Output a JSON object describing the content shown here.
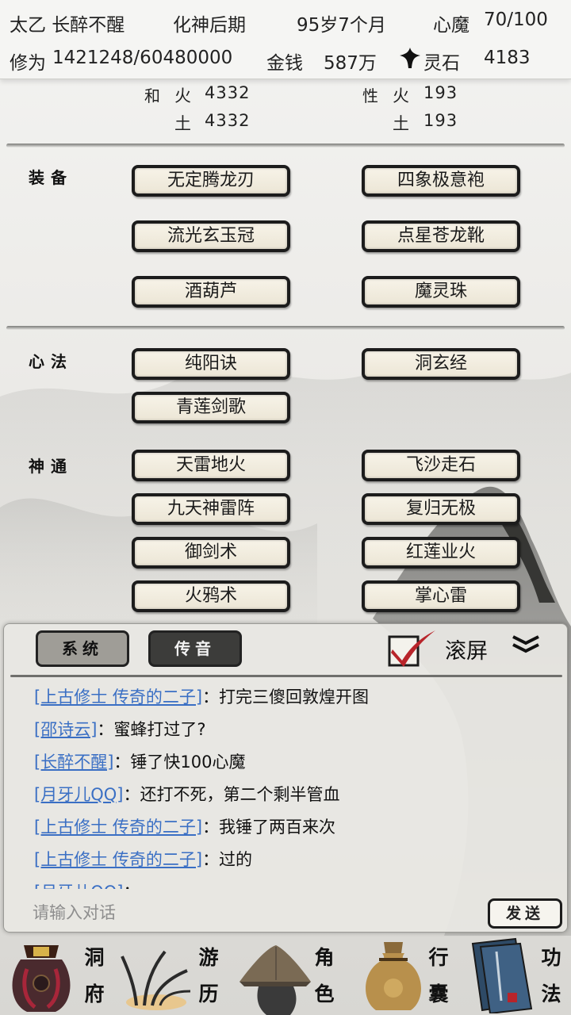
{
  "header": {
    "character_name": "太乙 长醉不醒",
    "realm": "化神后期",
    "age": "95岁7个月",
    "heart_demon_label": "心魔",
    "heart_demon_value": "70/100",
    "cultivation_label": "修为",
    "cultivation_value": "1421248/60480000",
    "money_label": "金钱",
    "money_value": "587万",
    "spirit_stone_label": "灵石",
    "spirit_stone_value": "4183"
  },
  "stats": {
    "left_vertical": "和",
    "left_rows": [
      {
        "element": "火",
        "value": "4332"
      },
      {
        "element": "土",
        "value": "4332"
      }
    ],
    "right_vertical": "性",
    "right_rows": [
      {
        "element": "火",
        "value": "193"
      },
      {
        "element": "土",
        "value": "193"
      }
    ]
  },
  "equipment": {
    "label": "装备",
    "items": [
      "无定腾龙刃",
      "四象极意袍",
      "流光玄玉冠",
      "点星苍龙靴",
      "酒葫芦",
      "魔灵珠"
    ]
  },
  "heart_methods": {
    "label": "心法",
    "items": [
      "纯阳诀",
      "洞玄经",
      "青莲剑歌"
    ]
  },
  "divine_arts": {
    "label": "神通",
    "items": [
      "天雷地火",
      "飞沙走石",
      "九天神雷阵",
      "复归无极",
      "御剑术",
      "红莲业火",
      "火鸦术",
      "掌心雷"
    ]
  },
  "chat": {
    "tab_system": "系统",
    "tab_voice": "传音",
    "scroll_label": "滚屏",
    "messages": [
      {
        "sender": "[上古修士 传奇的二子]",
        "text": "：打完三傻回敦煌开图"
      },
      {
        "sender": "[邵诗云]",
        "text": "：蜜蜂打过了?"
      },
      {
        "sender": "[长醉不醒]",
        "text": "：锤了快100心魔"
      },
      {
        "sender": "[月牙儿QQ]",
        "text": "：还打不死，第二个剩半管血"
      },
      {
        "sender": "[上古修士 传奇的二子]",
        "text": "：我锤了两百来次"
      },
      {
        "sender": "[上古修士 传奇的二子]",
        "text": "：过的"
      },
      {
        "sender": "[月牙儿QQ]",
        "text": "："
      }
    ],
    "input_placeholder": "请输入对话",
    "send_label": "发送"
  },
  "nav": {
    "items": [
      {
        "label_top": "洞",
        "label_bottom": "府",
        "icon": "treasure-bag-icon"
      },
      {
        "label_top": "游",
        "label_bottom": "历",
        "icon": "grass-icon"
      },
      {
        "label_top": "角",
        "label_bottom": "色",
        "icon": "straw-hat-icon"
      },
      {
        "label_top": "行",
        "label_bottom": "囊",
        "icon": "sack-icon"
      },
      {
        "label_top": "功",
        "label_bottom": "法",
        "icon": "book-icon"
      }
    ]
  },
  "colors": {
    "chat_sender": "#3a6fc4",
    "checkbox_check": "#c0262b",
    "button_fill": "#f3efe2",
    "button_border": "#1c1c1c"
  }
}
